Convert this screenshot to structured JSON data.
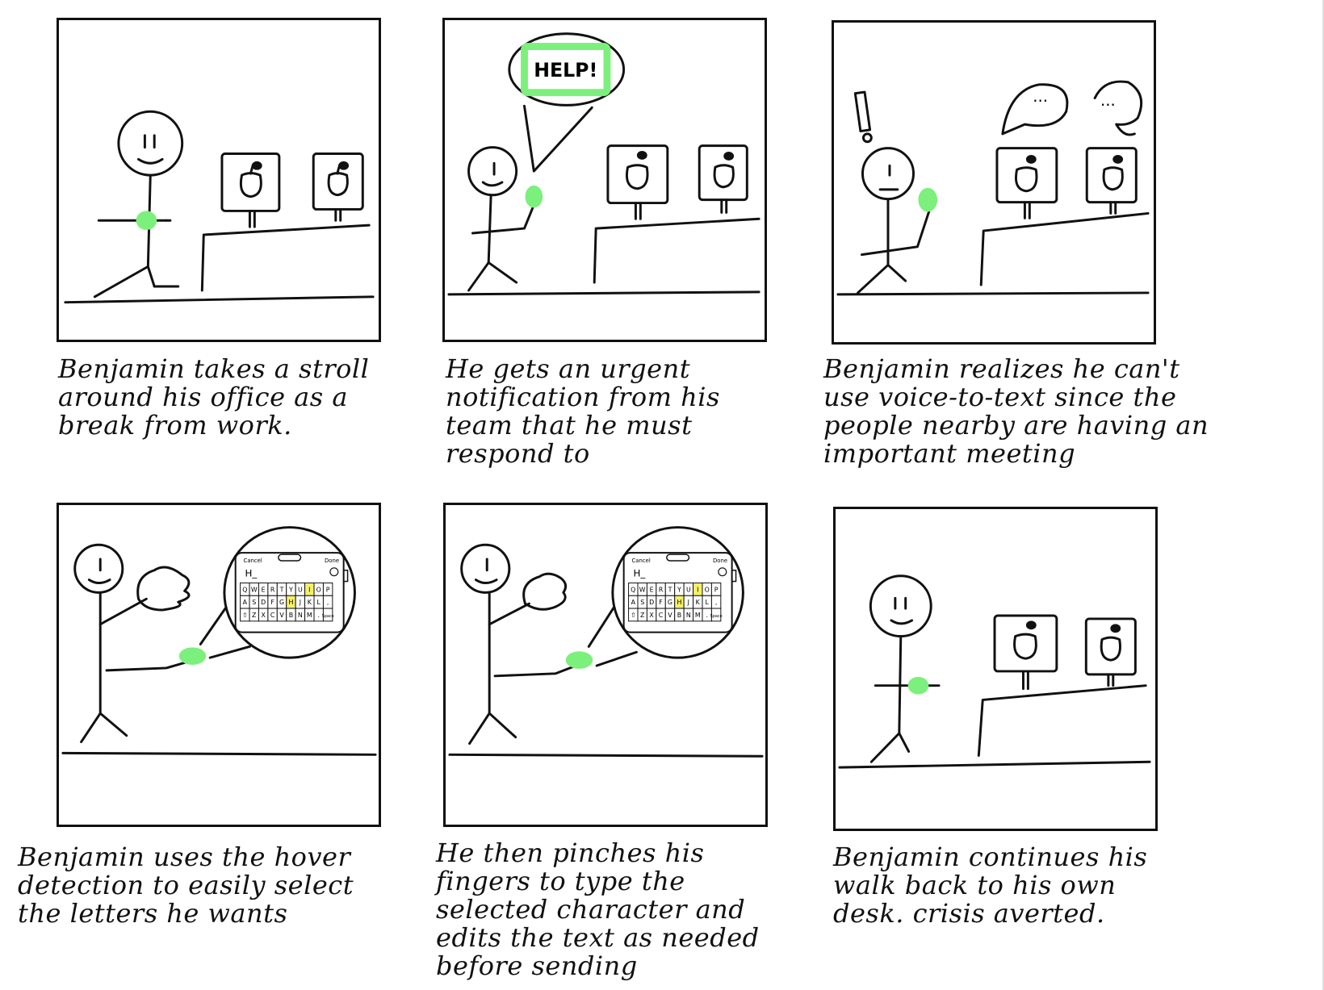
{
  "panels": [
    {
      "caption": "Benjamin takes a stroll around his office as a break from work."
    },
    {
      "caption": "He gets an urgent notification from his team that he must respond to",
      "bubble": "HELP!"
    },
    {
      "caption": "Benjamin realizes he can't use voice-to-text since the people nearby are having an important meeting"
    },
    {
      "caption": "Benjamin uses the hover detection to easily select the letters he wants"
    },
    {
      "caption": "He then pinches his fingers to type the selected character and edits the text as needed before sending"
    },
    {
      "caption": "Benjamin continues his walk back to his own desk. crisis averted."
    }
  ],
  "keyboard": {
    "cancel": "Cancel",
    "done": "Done",
    "typed": "H_",
    "rows": [
      [
        "Q",
        "W",
        "E",
        "R",
        "T",
        "Y",
        "U",
        "I",
        "O",
        "P"
      ],
      [
        "A",
        "S",
        "D",
        "F",
        "G",
        "H",
        "J",
        "K",
        "L",
        ","
      ],
      [
        "⇧",
        "Z",
        "X",
        "C",
        "V",
        "B",
        "N",
        "M",
        ".",
        "Space"
      ]
    ],
    "highlighted": [
      "I",
      "H"
    ]
  },
  "colors": {
    "highlight": "#7CF07C",
    "key_highlight": "#F6F06A",
    "ink": "#111111"
  }
}
